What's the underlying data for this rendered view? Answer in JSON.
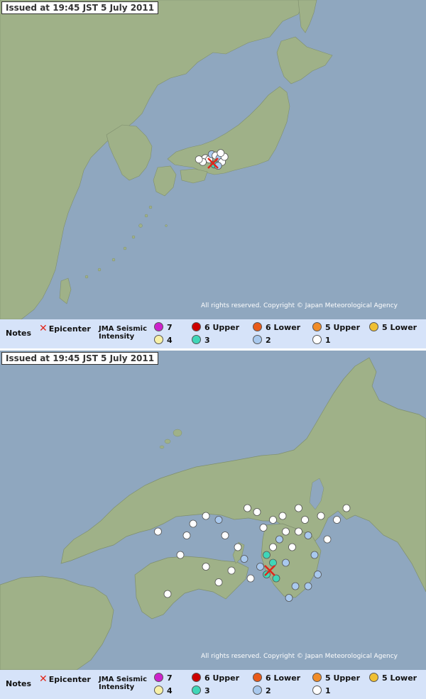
{
  "issued_label": "Issued at 19:45 JST  5 July 2011",
  "copyright": "All rights reserved. Copyright © Japan Meteorological Agency",
  "legend": {
    "notes": "Notes",
    "epicenter": "Epicenter",
    "epicenter_mark": "✕",
    "intensity_label_line1": "JMA Seismic",
    "intensity_label_line2": "Intensity",
    "items": [
      {
        "label": "7",
        "color": "#cc22cc"
      },
      {
        "label": "6 Upper",
        "color": "#cc0000"
      },
      {
        "label": "6 Lower",
        "color": "#e85a1a"
      },
      {
        "label": "5 Upper",
        "color": "#f08c28"
      },
      {
        "label": "5 Lower",
        "color": "#f0c032"
      },
      {
        "label": "4",
        "color": "#f7f0a6"
      },
      {
        "label": "3",
        "color": "#3fd6b8"
      },
      {
        "label": "2",
        "color": "#a9c9ee"
      },
      {
        "label": "1",
        "color": "#ffffff"
      }
    ]
  },
  "colors": {
    "sea": "#8fa7bf",
    "land": "#9fb188",
    "legend_bg": "#1f63de"
  },
  "map_overview": {
    "epicenter": {
      "lon": 135.3,
      "lat": 33.9
    },
    "stations": [
      {
        "lon": 134.7,
        "lat": 34.3,
        "i": 1
      },
      {
        "lon": 135.0,
        "lat": 34.2,
        "i": 1
      },
      {
        "lon": 135.2,
        "lat": 34.6,
        "i": 2
      },
      {
        "lon": 135.5,
        "lat": 34.5,
        "i": 1
      },
      {
        "lon": 135.8,
        "lat": 34.3,
        "i": 2
      },
      {
        "lon": 136.0,
        "lat": 34.0,
        "i": 1
      },
      {
        "lon": 135.4,
        "lat": 33.8,
        "i": 3
      },
      {
        "lon": 135.7,
        "lat": 33.7,
        "i": 2
      },
      {
        "lon": 134.5,
        "lat": 34.0,
        "i": 1
      },
      {
        "lon": 134.2,
        "lat": 34.2,
        "i": 1
      },
      {
        "lon": 136.2,
        "lat": 34.4,
        "i": 1
      },
      {
        "lon": 135.9,
        "lat": 34.7,
        "i": 1
      }
    ]
  },
  "map_detail": {
    "epicenter": {
      "lon": 135.3,
      "lat": 33.9
    },
    "stations": [
      {
        "lon": 134.1,
        "lat": 34.5,
        "i": 1
      },
      {
        "lon": 134.0,
        "lat": 34.35,
        "i": 1
      },
      {
        "lon": 134.3,
        "lat": 34.6,
        "i": 1
      },
      {
        "lon": 134.5,
        "lat": 34.55,
        "i": 2
      },
      {
        "lon": 134.6,
        "lat": 34.35,
        "i": 1
      },
      {
        "lon": 134.8,
        "lat": 34.2,
        "i": 1
      },
      {
        "lon": 134.9,
        "lat": 34.05,
        "i": 2
      },
      {
        "lon": 134.7,
        "lat": 33.9,
        "i": 1
      },
      {
        "lon": 134.5,
        "lat": 33.75,
        "i": 1
      },
      {
        "lon": 134.3,
        "lat": 33.95,
        "i": 1
      },
      {
        "lon": 133.9,
        "lat": 34.1,
        "i": 1
      },
      {
        "lon": 134.95,
        "lat": 34.7,
        "i": 1
      },
      {
        "lon": 135.1,
        "lat": 34.65,
        "i": 1
      },
      {
        "lon": 135.2,
        "lat": 34.45,
        "i": 1
      },
      {
        "lon": 135.35,
        "lat": 34.55,
        "i": 1
      },
      {
        "lon": 135.5,
        "lat": 34.6,
        "i": 1
      },
      {
        "lon": 135.55,
        "lat": 34.4,
        "i": 1
      },
      {
        "lon": 135.45,
        "lat": 34.3,
        "i": 2
      },
      {
        "lon": 135.35,
        "lat": 34.2,
        "i": 1
      },
      {
        "lon": 135.25,
        "lat": 34.1,
        "i": 3
      },
      {
        "lon": 135.35,
        "lat": 34.0,
        "i": 3
      },
      {
        "lon": 135.25,
        "lat": 33.85,
        "i": 3
      },
      {
        "lon": 135.4,
        "lat": 33.8,
        "i": 3
      },
      {
        "lon": 135.55,
        "lat": 34.0,
        "i": 2
      },
      {
        "lon": 135.65,
        "lat": 34.2,
        "i": 1
      },
      {
        "lon": 135.75,
        "lat": 34.4,
        "i": 1
      },
      {
        "lon": 135.85,
        "lat": 34.55,
        "i": 1
      },
      {
        "lon": 135.75,
        "lat": 34.7,
        "i": 1
      },
      {
        "lon": 135.9,
        "lat": 34.35,
        "i": 2
      },
      {
        "lon": 136.0,
        "lat": 34.1,
        "i": 2
      },
      {
        "lon": 135.7,
        "lat": 33.7,
        "i": 2
      },
      {
        "lon": 135.9,
        "lat": 33.7,
        "i": 2
      },
      {
        "lon": 136.05,
        "lat": 33.85,
        "i": 2
      },
      {
        "lon": 136.2,
        "lat": 34.3,
        "i": 1
      },
      {
        "lon": 136.35,
        "lat": 34.55,
        "i": 1
      },
      {
        "lon": 136.5,
        "lat": 34.7,
        "i": 1
      },
      {
        "lon": 136.1,
        "lat": 34.6,
        "i": 1
      },
      {
        "lon": 135.0,
        "lat": 33.8,
        "i": 1
      },
      {
        "lon": 133.7,
        "lat": 33.6,
        "i": 1
      },
      {
        "lon": 133.55,
        "lat": 34.4,
        "i": 1
      },
      {
        "lon": 135.15,
        "lat": 33.95,
        "i": 2
      },
      {
        "lon": 135.6,
        "lat": 33.55,
        "i": 2
      }
    ]
  }
}
